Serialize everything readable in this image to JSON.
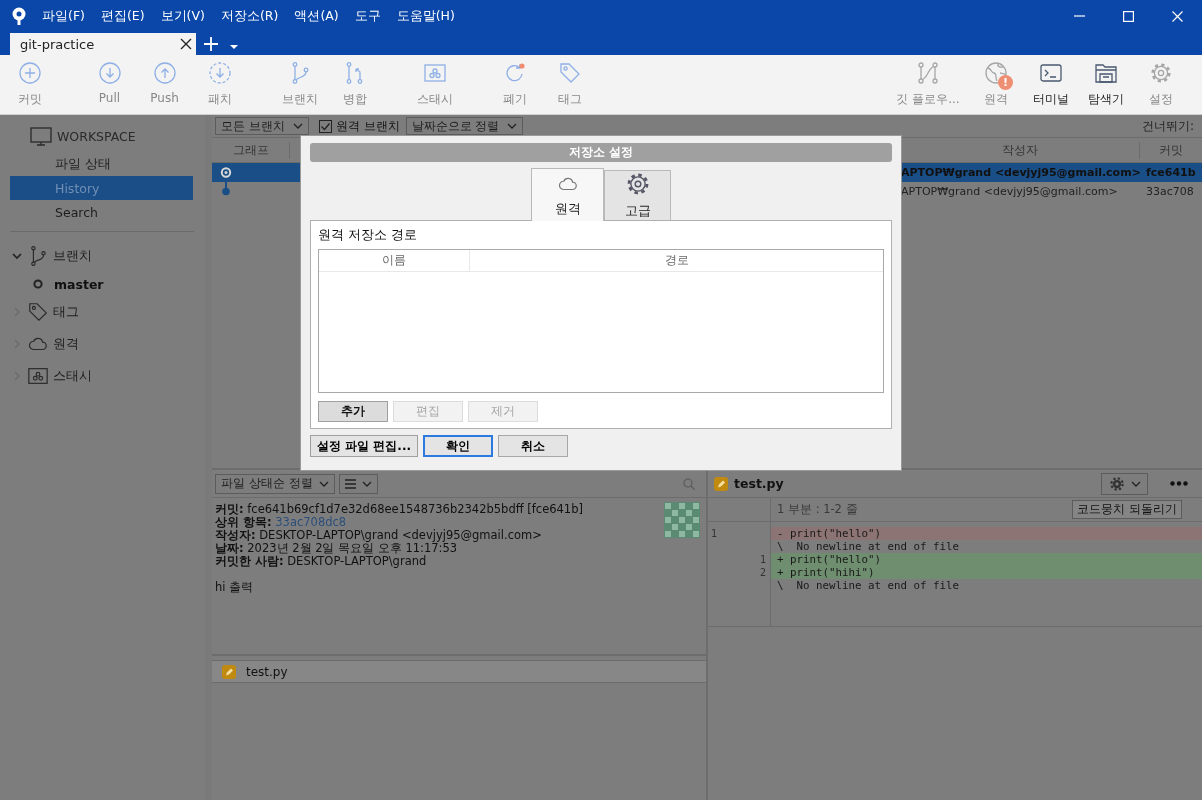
{
  "window": {
    "menu": [
      "파일(F)",
      "편집(E)",
      "보기(V)",
      "저장소(R)",
      "액션(A)",
      "도구",
      "도움말(H)"
    ]
  },
  "tabs": [
    {
      "label": "git-practice",
      "selected": true
    }
  ],
  "toolbar": {
    "left_groups": [
      [
        {
          "label": "커밋",
          "kind": "commit",
          "disabled": true
        }
      ],
      [
        {
          "label": "Pull",
          "kind": "pull",
          "disabled": true
        },
        {
          "label": "Push",
          "kind": "push",
          "disabled": true
        },
        {
          "label": "패치",
          "kind": "fetch",
          "disabled": true
        }
      ],
      [
        {
          "label": "브랜치",
          "kind": "branch",
          "disabled": true
        },
        {
          "label": "병합",
          "kind": "merge",
          "disabled": true
        }
      ],
      [
        {
          "label": "스태시",
          "kind": "stash",
          "disabled": true
        }
      ],
      [
        {
          "label": "폐기",
          "kind": "discard",
          "disabled": true
        },
        {
          "label": "태그",
          "kind": "tag",
          "disabled": true
        }
      ]
    ],
    "right": [
      {
        "label": "깃 플로우...",
        "kind": "gitflow",
        "disabled": true
      },
      {
        "label": "원격",
        "kind": "remote",
        "disabled": true,
        "badge": "!"
      },
      {
        "label": "터미널",
        "kind": "terminal",
        "disabled": false
      },
      {
        "label": "탐색기",
        "kind": "explorer",
        "disabled": false
      },
      {
        "label": "설정",
        "kind": "settings",
        "disabled": true
      }
    ]
  },
  "sidebar": {
    "workspace": "WORKSPACE",
    "items": [
      {
        "label": "파일 상태",
        "selected": false
      },
      {
        "label": "History",
        "selected": true
      },
      {
        "label": "Search",
        "selected": false
      }
    ],
    "sections": [
      {
        "label": "브랜치",
        "kind": "branch",
        "expanded": true,
        "children": [
          {
            "label": "master"
          }
        ]
      },
      {
        "label": "태그",
        "kind": "tag",
        "expanded": false
      },
      {
        "label": "원격",
        "kind": "cloud",
        "expanded": false
      },
      {
        "label": "스태시",
        "kind": "stash",
        "expanded": false
      }
    ]
  },
  "history": {
    "branch_filter": "모든 브랜치",
    "remote_branches": {
      "label": "원격 브랜치",
      "checked": true
    },
    "sort": "날짜순으로 정렬",
    "skip_label": "건너뛰기:",
    "columns": [
      "그래프",
      "작성자",
      "커밋"
    ],
    "rows": [
      {
        "author": "APTOP₩grand <devjyj95@gmail.com>",
        "commit": "fce641b",
        "selected": true,
        "head": true
      },
      {
        "author": "APTOP₩grand <devjyj95@gmail.com>",
        "commit": "33ac708",
        "selected": false,
        "head": false
      }
    ]
  },
  "details": {
    "sort": "파일 상태순 정렬",
    "fields": [
      {
        "label": "커밋:",
        "value": "fce641b69cf1d7e32d68ee1548736b2342b5bdff [fce641b]",
        "kind": "text"
      },
      {
        "label": "상위 항목:",
        "value": "33ac708dc8",
        "kind": "link"
      },
      {
        "label": "작성자:",
        "value": "DESKTOP-LAPTOP\\grand <devjyj95@gmail.com>",
        "kind": "text"
      },
      {
        "label": "날짜:",
        "value": "2023년 2월 2일 목요일 오후 11:17:53",
        "kind": "text"
      },
      {
        "label": "커밋한 사람:",
        "value": "DESKTOP-LAPTOP\\grand",
        "kind": "text"
      }
    ],
    "message": "hi 출력",
    "files": [
      {
        "name": "test.py"
      }
    ]
  },
  "diff": {
    "file": "test.py",
    "hunk": "1 부분 : 1-2 줄",
    "revert": "코드뭉치 되돌리기",
    "lines": [
      {
        "kind": "removed",
        "old": "1",
        "text": "- print(\"hello\")"
      },
      {
        "kind": "context",
        "text": "\\  No newline at end of file"
      },
      {
        "kind": "added",
        "new": "1",
        "text": "+ print(\"hello\")"
      },
      {
        "kind": "added",
        "new": "2",
        "text": "+ print(\"hihi\")"
      },
      {
        "kind": "context",
        "text": "\\  No newline at end of file"
      }
    ]
  },
  "dialog": {
    "title": "저장소 설정",
    "tabs": [
      {
        "label": "원격",
        "kind": "cloud",
        "selected": true
      },
      {
        "label": "고급",
        "kind": "gear",
        "selected": false
      }
    ],
    "section": "원격 저장소 경로",
    "columns": [
      "이름",
      "경로"
    ],
    "buttons": [
      {
        "label": "추가",
        "disabled": false
      },
      {
        "label": "편집",
        "disabled": true
      },
      {
        "label": "제거",
        "disabled": true
      }
    ],
    "edit_config": "설정 파일 편집...",
    "actions": [
      {
        "label": "확인",
        "default": true
      },
      {
        "label": "취소",
        "default": false
      }
    ]
  }
}
